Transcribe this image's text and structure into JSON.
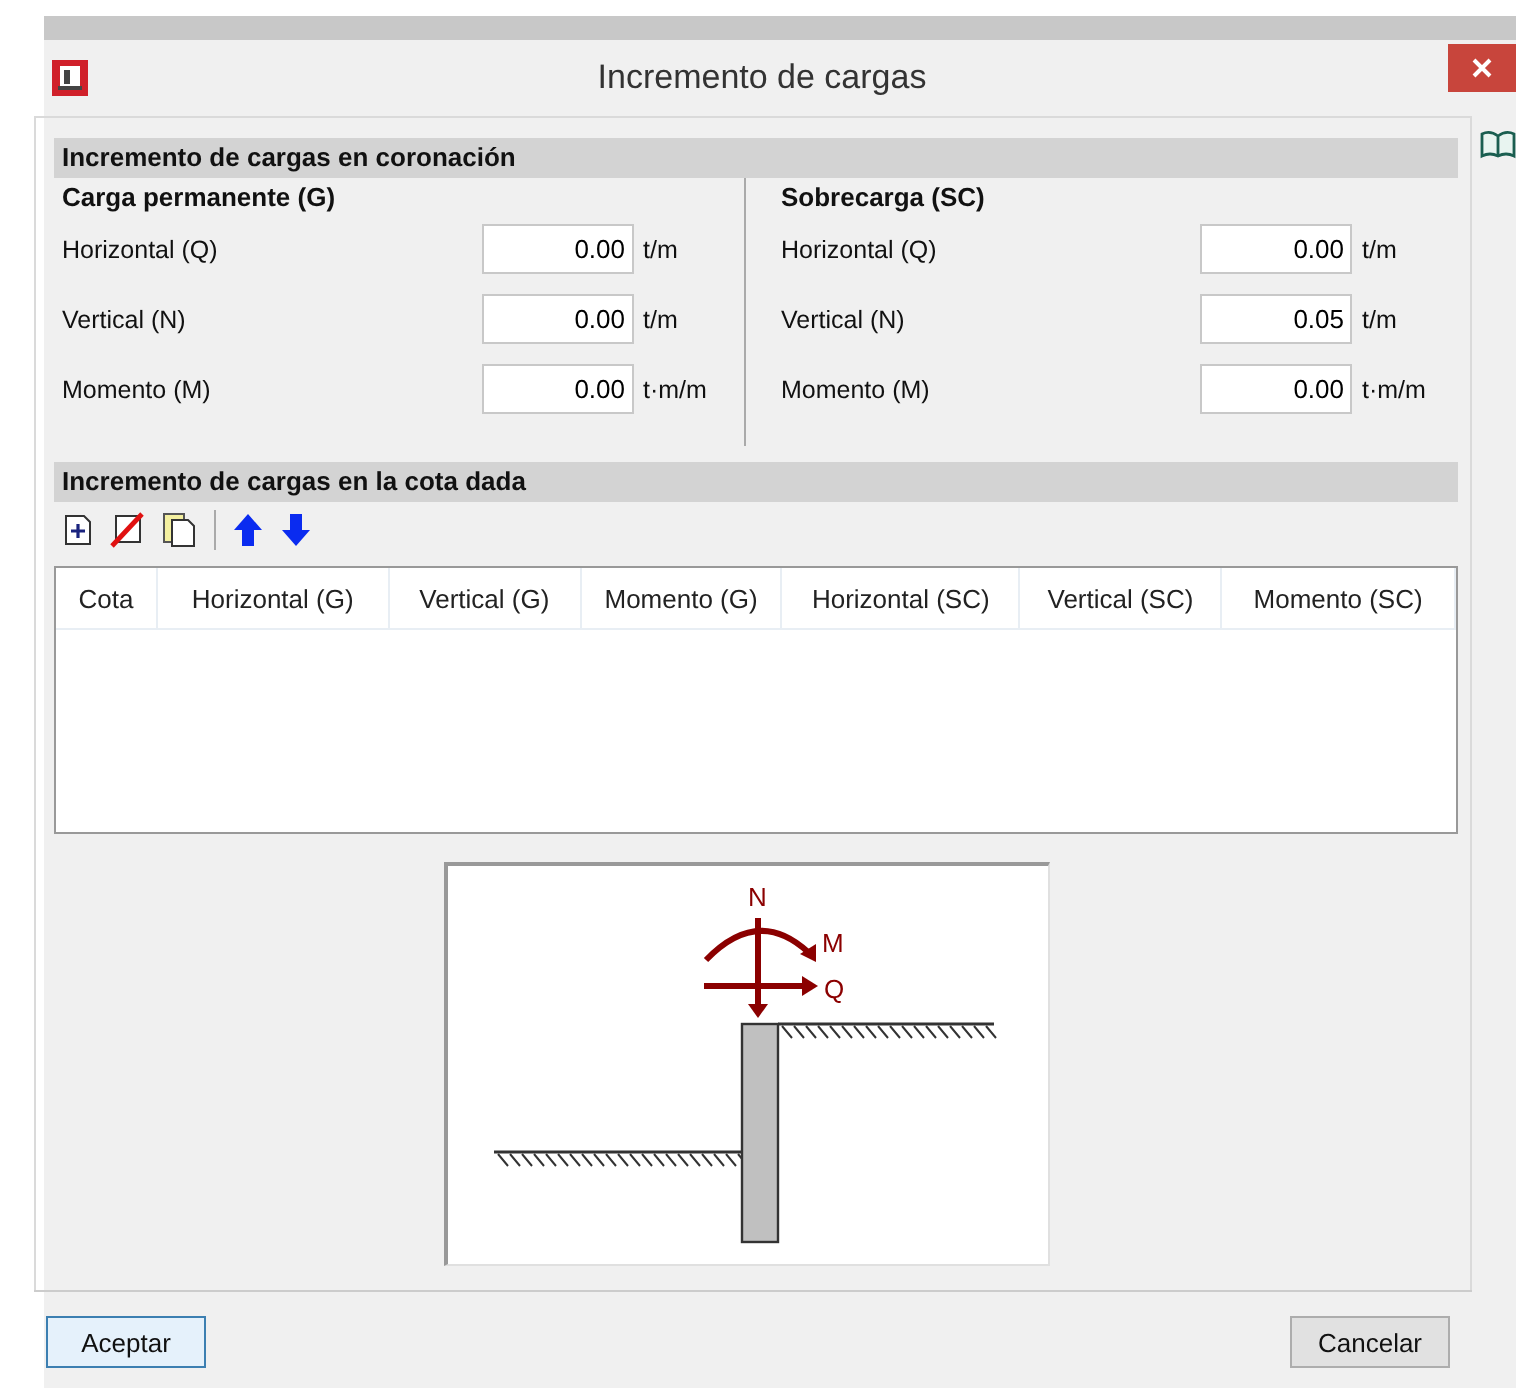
{
  "window": {
    "title": "Incremento de cargas"
  },
  "crown_section": {
    "title": "Incremento de cargas en coronación",
    "groups": [
      {
        "title": "Carga permanente (G)",
        "rows": [
          {
            "label": "Horizontal (Q)",
            "value": "0.00",
            "unit": "t/m"
          },
          {
            "label": "Vertical (N)",
            "value": "0.00",
            "unit": "t/m"
          },
          {
            "label": "Momento (M)",
            "value": "0.00",
            "unit": "t·m/m"
          }
        ]
      },
      {
        "title": "Sobrecarga (SC)",
        "rows": [
          {
            "label": "Horizontal (Q)",
            "value": "0.00",
            "unit": "t/m"
          },
          {
            "label": "Vertical (N)",
            "value": "0.05",
            "unit": "t/m"
          },
          {
            "label": "Momento (M)",
            "value": "0.00",
            "unit": "t·m/m"
          }
        ]
      }
    ]
  },
  "depth_section": {
    "title": "Incremento de cargas en la cota dada",
    "table": {
      "columns": [
        "Cota",
        "Horizontal (G)",
        "Vertical (G)",
        "Momento (G)",
        "Horizontal (SC)",
        "Vertical (SC)",
        "Momento (SC)"
      ]
    }
  },
  "diagram": {
    "labels": {
      "vertical": "N",
      "moment": "M",
      "horizontal": "Q"
    }
  },
  "buttons": [
    {
      "label": "Aceptar",
      "default": true
    },
    {
      "label": "Cancelar",
      "default": false
    }
  ]
}
